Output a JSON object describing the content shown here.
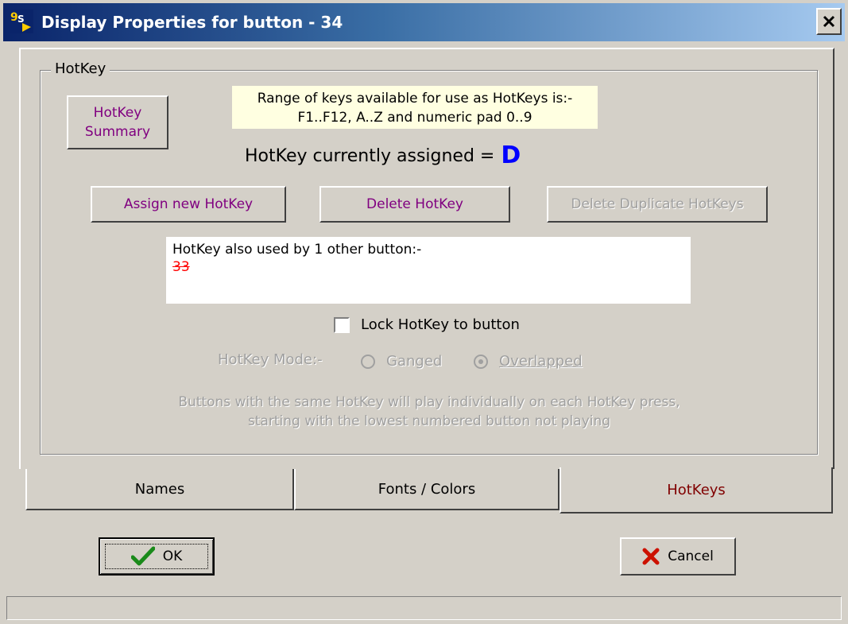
{
  "window": {
    "title": "Display Properties for button - 34",
    "icon": "app-icon",
    "close_icon": "close-icon"
  },
  "group": {
    "label": "HotKey",
    "summary_button": {
      "line1": "HotKey",
      "line2": "Summary"
    },
    "info": {
      "line1": "Range of keys available for use as HotKeys is:-",
      "line2": "F1..F12, A..Z and numeric pad 0..9"
    },
    "current_label": "HotKey currently assigned =",
    "current_key": "D",
    "buttons": {
      "assign": "Assign new HotKey",
      "delete": "Delete HotKey",
      "delete_duplicates": "Delete Duplicate HotKeys"
    },
    "used_by": {
      "heading": "HotKey also used by 1 other button:-",
      "items": [
        "33"
      ]
    },
    "lock_label": "Lock HotKey to button",
    "lock_checked": false,
    "mode_label": "HotKey Mode:-",
    "mode_options": [
      "Ganged",
      "Overlapped"
    ],
    "mode_selected": "Overlapped",
    "description_line1": "Buttons with the same HotKey will play individually on each HotKey press,",
    "description_line2": "starting with the lowest numbered button not playing"
  },
  "tabs": [
    "Names",
    "Fonts / Colors",
    "HotKeys"
  ],
  "active_tab": "HotKeys",
  "footer": {
    "ok_label": "OK",
    "cancel_label": "Cancel"
  },
  "colors": {
    "title_start": "#0a246a",
    "button_text": "#800080",
    "key_blue": "#0000ff",
    "active_tab_text": "#800000",
    "used_red": "#ff0000",
    "info_bg": "#ffffe1"
  }
}
